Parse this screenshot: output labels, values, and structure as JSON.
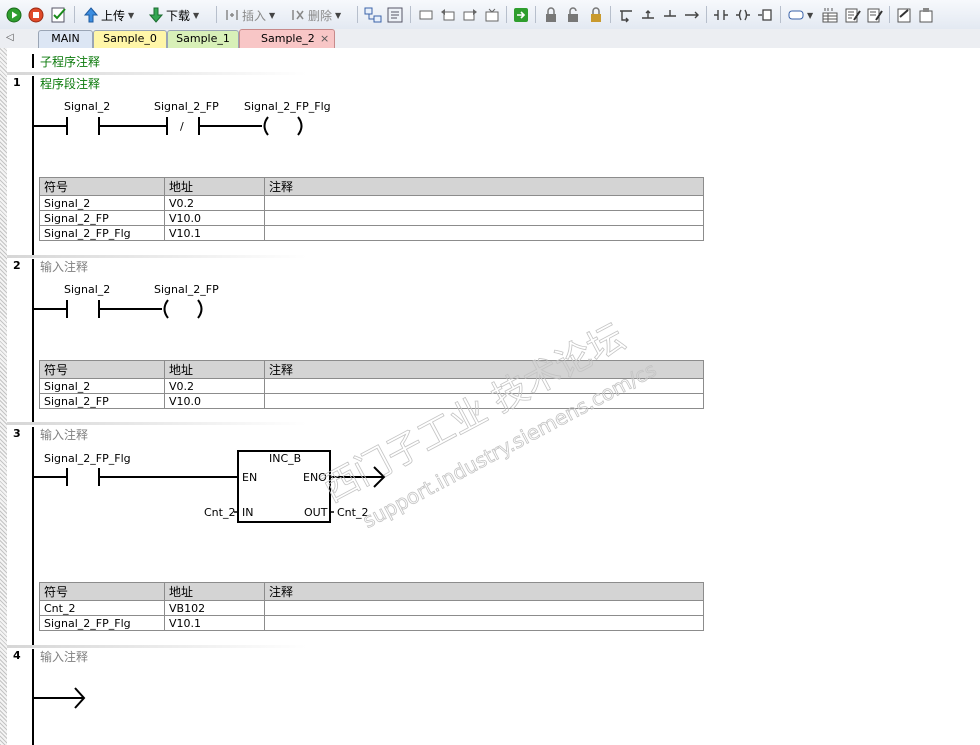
{
  "toolbar": {
    "upload_label": "上传",
    "download_label": "下载",
    "insert_label": "插入",
    "delete_label": "删除"
  },
  "tabs": [
    "MAIN",
    "Sample_0",
    "Sample_1",
    "Sample_2"
  ],
  "subroutine_comment": "子程序注释",
  "table_headers": [
    "符号",
    "地址",
    "注释"
  ],
  "networks": [
    {
      "num": "1",
      "comment": "程序段注释",
      "labels": [
        "Signal_2",
        "Signal_2_FP",
        "Signal_2_FP_Flg"
      ],
      "contact_mark": "/",
      "rows": [
        [
          "Signal_2",
          "V0.2",
          ""
        ],
        [
          "Signal_2_FP",
          "V10.0",
          ""
        ],
        [
          "Signal_2_FP_Flg",
          "V10.1",
          ""
        ]
      ]
    },
    {
      "num": "2",
      "comment": "输入注释",
      "labels": [
        "Signal_2",
        "Signal_2_FP"
      ],
      "rows": [
        [
          "Signal_2",
          "V0.2",
          ""
        ],
        [
          "Signal_2_FP",
          "V10.0",
          ""
        ]
      ]
    },
    {
      "num": "3",
      "comment": "输入注释",
      "contact_label": "Signal_2_FP_Flg",
      "box": {
        "name": "INC_B",
        "en": "EN",
        "eno": "ENO",
        "in": "IN",
        "out": "OUT",
        "in_operand": "Cnt_2",
        "out_operand": "Cnt_2"
      },
      "rows": [
        [
          "Cnt_2",
          "VB102",
          ""
        ],
        [
          "Signal_2_FP_Flg",
          "V10.1",
          ""
        ]
      ]
    },
    {
      "num": "4",
      "comment": "输入注释"
    }
  ],
  "watermark": {
    "line1": "西门子工业  技术论坛",
    "line2": "support.industry.siemens.com/cs"
  },
  "colors": {
    "tab_main": "#dce6f4",
    "tab_sample0": "#fff6a8",
    "tab_sample1": "#d8f0b8",
    "tab_sample2": "#f8c6c6",
    "comment_green": "#0b7a0b"
  }
}
